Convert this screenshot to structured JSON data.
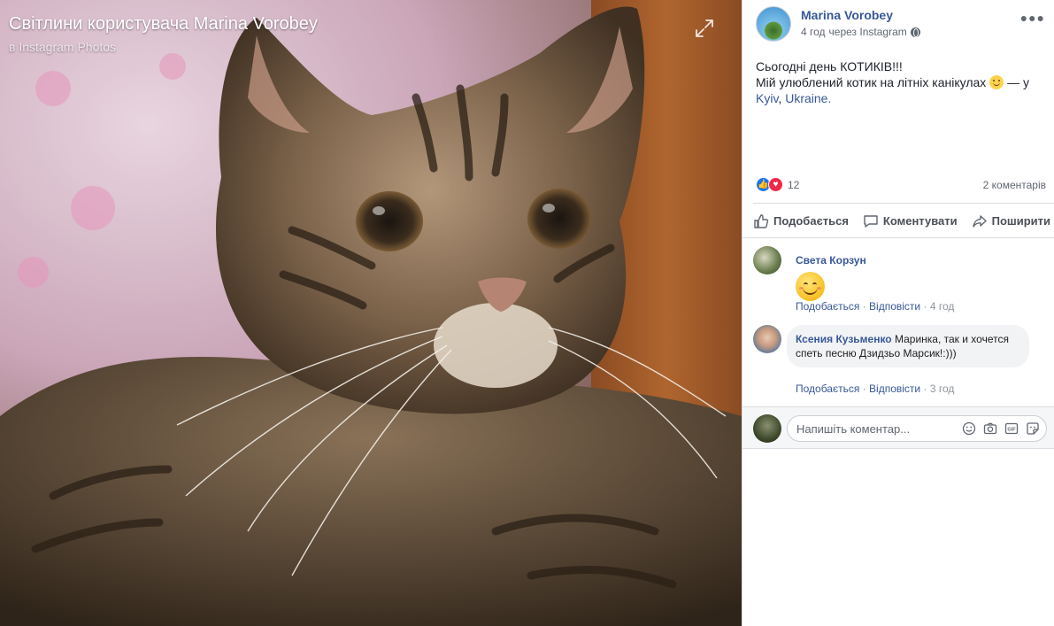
{
  "photo": {
    "title": "Світлини користувача Marina Vorobey",
    "subtitle_prefix": "в",
    "subtitle_source": "Instagram Photos"
  },
  "post": {
    "author": "Marina Vorobey",
    "time": "4 год",
    "via": "через Instagram",
    "line1": "Сьогодні день КОТИКІВ!!!",
    "line2": "Мій улюблений котик на літніх канікулах",
    "at": "— у",
    "location_city": "Kyiv",
    "location_country": "Ukraine."
  },
  "stats": {
    "reactions_count": "12",
    "comments_count": "2 коментарів"
  },
  "actions": {
    "like": "Подобається",
    "comment": "Коментувати",
    "share": "Поширити"
  },
  "comments": [
    {
      "name": "Света Корзун",
      "text": "",
      "like": "Подобається",
      "reply": "Відповісти",
      "time": "4 год"
    },
    {
      "name": "Ксения Кузьменко",
      "text": "Маринка, так и хочется спеть песню Дзидзьо Марсик!:)))",
      "like": "Подобається",
      "reply": "Відповісти",
      "time": "3 год"
    }
  ],
  "composer": {
    "placeholder": "Напишіть коментар..."
  },
  "colors": {
    "link": "#385898",
    "like_reaction": "#1877f2",
    "love_reaction": "#f0284a"
  }
}
